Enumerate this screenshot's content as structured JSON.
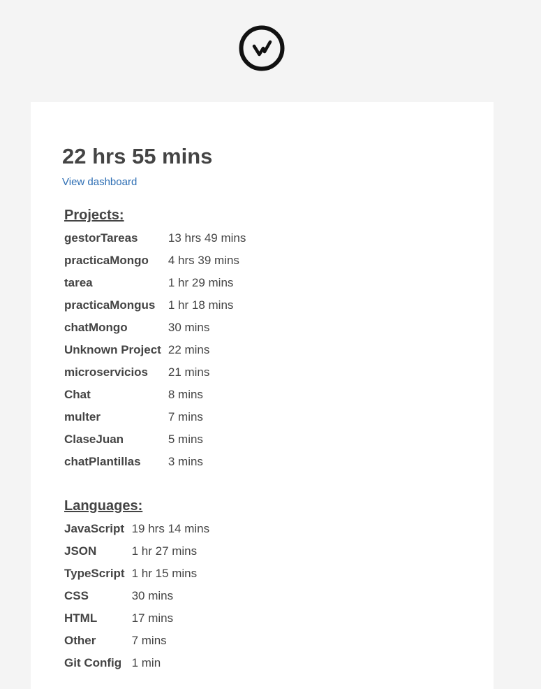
{
  "logo": {
    "icon": "wakatime-logo-icon"
  },
  "summary": {
    "total_time": "22 hrs 55 mins",
    "dashboard_link": "View dashboard"
  },
  "projects": {
    "title": "Projects:",
    "rows": [
      {
        "name": "gestorTareas",
        "time": "13 hrs 49 mins"
      },
      {
        "name": "practicaMongo",
        "time": "4 hrs 39 mins"
      },
      {
        "name": "tarea",
        "time": "1 hr 29 mins"
      },
      {
        "name": "practicaMongus",
        "time": "1 hr 18 mins"
      },
      {
        "name": "chatMongo",
        "time": "30 mins"
      },
      {
        "name": "Unknown Project",
        "time": "22 mins"
      },
      {
        "name": "microservicios",
        "time": "21 mins"
      },
      {
        "name": "Chat",
        "time": "8 mins"
      },
      {
        "name": "multer",
        "time": "7 mins"
      },
      {
        "name": "ClaseJuan",
        "time": "5 mins"
      },
      {
        "name": "chatPlantillas",
        "time": "3 mins"
      }
    ]
  },
  "languages": {
    "title": "Languages:",
    "rows": [
      {
        "name": "JavaScript",
        "time": "19 hrs 14 mins"
      },
      {
        "name": "JSON",
        "time": "1 hr 27 mins"
      },
      {
        "name": "TypeScript",
        "time": "1 hr 15 mins"
      },
      {
        "name": "CSS",
        "time": "30 mins"
      },
      {
        "name": "HTML",
        "time": "17 mins"
      },
      {
        "name": "Other",
        "time": "7 mins"
      },
      {
        "name": "Git Config",
        "time": "1 min"
      }
    ]
  }
}
